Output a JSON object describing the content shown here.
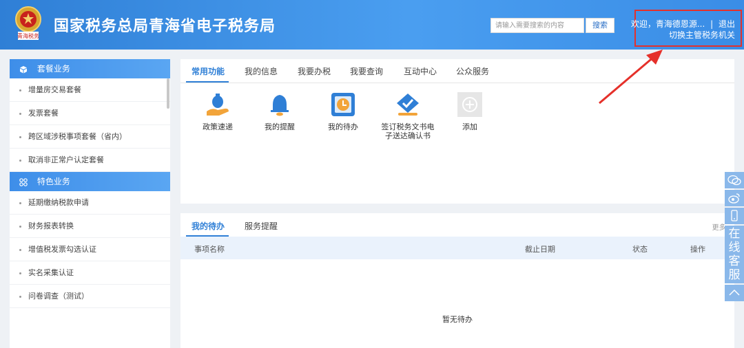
{
  "header": {
    "emblem_text": "青海税务",
    "title": "国家税务总局青海省电子税务局",
    "search_placeholder": "请输入需要搜索的内容",
    "search_button": "搜索",
    "welcome": "欢迎，青海德恩源...",
    "separator": "|",
    "logout": "退出",
    "switch_org": "切换主管税务机关"
  },
  "sidebar": {
    "section1": {
      "title": "套餐业务",
      "icon": "cube-icon",
      "items": [
        "增量房交易套餐",
        "发票套餐",
        "跨区域涉税事项套餐（省内）",
        "取消非正常户认定套餐"
      ]
    },
    "section2": {
      "title": "特色业务",
      "icon": "grid-icon",
      "items": [
        "延期缴纳税款申请",
        "财务报表转换",
        "增值税发票勾选认证",
        "实名采集认证",
        "问卷调查（测试）"
      ]
    }
  },
  "main_tabs": [
    "常用功能",
    "我的信息",
    "我要办税",
    "我要查询",
    "互动中心",
    "公众服务"
  ],
  "functions": [
    {
      "label": "政策速递",
      "icon": "money-bag-hand-icon"
    },
    {
      "label": "我的提醒",
      "icon": "bell-icon"
    },
    {
      "label": "我的待办",
      "icon": "clock-icon"
    },
    {
      "label": "签订税务文书电子送达确认书",
      "icon": "document-check-icon"
    },
    {
      "label": "添加",
      "icon": "plus-icon"
    }
  ],
  "todo": {
    "tabs": [
      "我的待办",
      "服务提醒"
    ],
    "more": "更多>",
    "columns": [
      "事项名称",
      "截止日期",
      "状态",
      "操作"
    ],
    "empty": "暂无待办"
  },
  "floater": {
    "chat_text": [
      "在",
      "线",
      "客",
      "服"
    ],
    "icons": [
      "wechat-icon",
      "weibo-icon",
      "mobile-icon",
      "chevron-up-icon"
    ]
  },
  "colors": {
    "brand": "#2f7fd6",
    "highlight": "#e5302a",
    "floater": "#8ab8ea"
  }
}
